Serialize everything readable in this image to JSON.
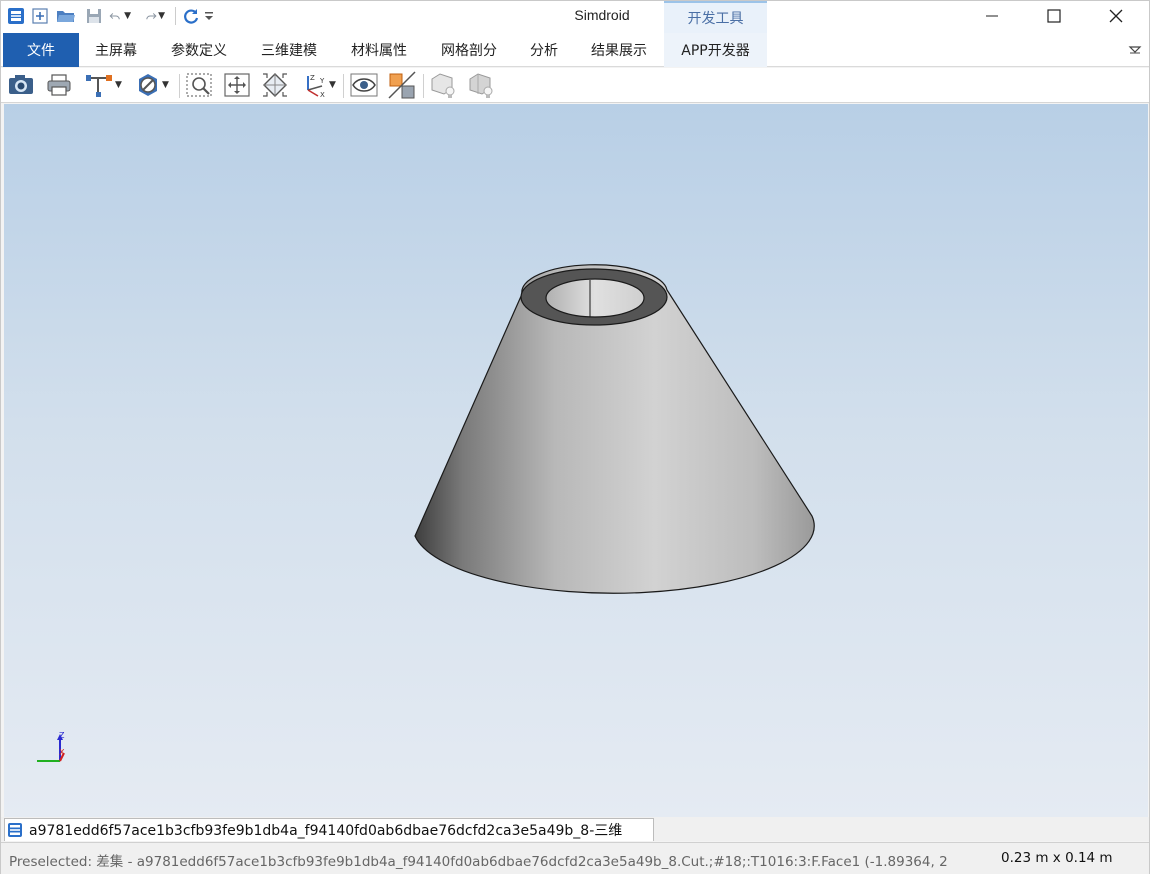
{
  "titlebar": {
    "app_title": "Simdroid",
    "context_tab": "开发工具",
    "quick_access": [
      "app-icon",
      "new-icon",
      "open-folder-icon",
      "save-icon",
      "undo-icon",
      "redo-icon",
      "refresh-icon",
      "customize-icon"
    ]
  },
  "ribbon": {
    "tabs": [
      {
        "label": "文件"
      },
      {
        "label": "主屏幕"
      },
      {
        "label": "参数定义"
      },
      {
        "label": "三维建模"
      },
      {
        "label": "材料属性"
      },
      {
        "label": "网格剖分"
      },
      {
        "label": "分析"
      },
      {
        "label": "结果展示"
      },
      {
        "label": "APP开发器"
      }
    ]
  },
  "toolbar": {
    "tools": [
      "camera-icon",
      "print-icon",
      "axis-select-icon",
      "clip-icon",
      "zoom-box-icon",
      "fit-all-icon",
      "view-cube-icon",
      "axes-orient-icon",
      "eye-icon",
      "edge-toggle-icon",
      "light-1-icon",
      "light-2-icon"
    ]
  },
  "viewport": {
    "axis_labels": {
      "z": "Z",
      "x": "X"
    }
  },
  "doc_tab": {
    "label": "a9781edd6f57ace1b3cfb93fe9b1db4a_f94140fd0ab6dbae76dcfd2ca3e5a49b_8-三维"
  },
  "status": {
    "text": "Preselected: 差集 - a9781edd6f57ace1b3cfb93fe9b1db4a_f94140fd0ab6dbae76dcfd2ca3e5a49b_8.Cut.;#18;:T1016:3:F.Face1 (-1.89364, 2",
    "dims": "0.23 m x 0.14 m"
  },
  "colors": {
    "accent": "#1f5fb0",
    "viewport_top": "#b8cfe6",
    "viewport_bottom": "#e5ebf3"
  }
}
